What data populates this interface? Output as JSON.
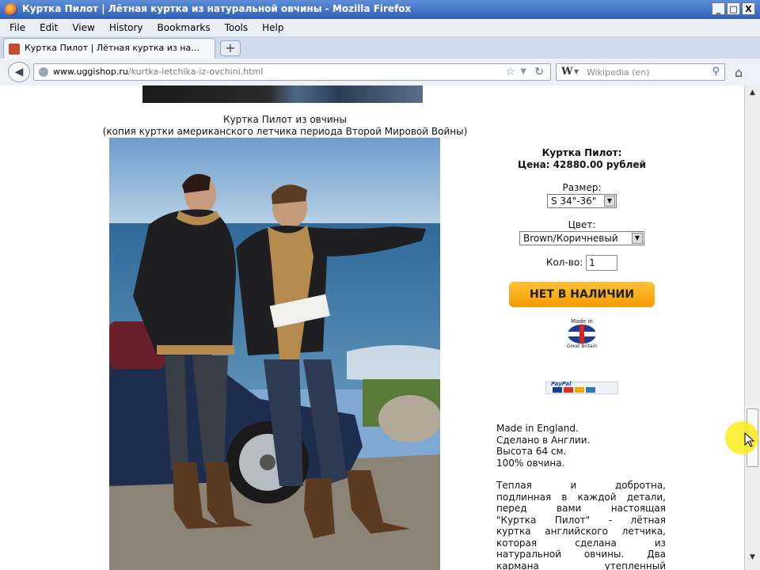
{
  "window": {
    "title": "Куртка Пилот | Лётная куртка из натуральной овчины - Mozilla Firefox",
    "buttons": {
      "minimize": "_",
      "restore": "□",
      "close": "X"
    }
  },
  "menu": [
    "File",
    "Edit",
    "View",
    "History",
    "Bookmarks",
    "Tools",
    "Help"
  ],
  "tab": {
    "label": "Куртка Пилот | Лётная куртка из натура...",
    "new_tab": "+"
  },
  "nav": {
    "url_domain": "www.uggishop.ru",
    "url_path": "/kurtka-letchika-iz-ovchini.html",
    "search_engine": "W",
    "search_placeholder": "Wikipedia (en)"
  },
  "page": {
    "caption_line1": "Куртка Пилот из овчины",
    "caption_line2": "(копия куртки американского летчика периода Второй Мировой Войны)",
    "product_title": "Куртка Пилот:",
    "price": "Цена: 42880.00 рублей",
    "size_label": "Размер:",
    "size_value": "S 34\"-36\"",
    "color_label": "Цвет:",
    "color_value": "Brown/Коричневый",
    "qty_label": "Кол-во:",
    "qty_value": "1",
    "buy_button": "НЕТ В НАЛИЧИИ",
    "badge_top": "Made in",
    "badge_bottom": "Great Britain",
    "paypal_label": "PayPal",
    "desc_lines": [
      "Made in England.",
      "Сделано в Англии.",
      "Высота 64 см.",
      "100% овчина."
    ],
    "desc_justified": [
      "Теплая и добротна,",
      "подлинная в каждой детали,",
      "перед вами настоящая",
      "\"Куртка Пилот\" - лётная",
      "куртка английского летчика,",
      "которая сделана из",
      "натуральной овчины. Два",
      "кармана утепленный"
    ]
  },
  "colors": {
    "titlebar": "#2f5fb7",
    "button_orange": "#f39b00",
    "cursor_highlight": "#ffeb00"
  },
  "icons": [
    "firefox-icon",
    "back-arrow-icon",
    "globe-icon",
    "star-icon",
    "reload-icon",
    "search-icon",
    "home-icon"
  ]
}
